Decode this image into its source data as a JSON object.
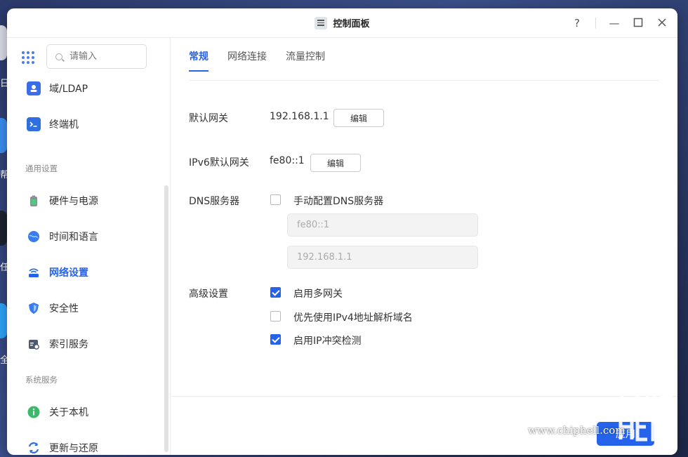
{
  "desktop": {
    "side_chars": [
      "日",
      "帮",
      "任",
      "全"
    ]
  },
  "window": {
    "title": "控制面板",
    "icon": "control-panel-icon"
  },
  "sidebar": {
    "search_placeholder": "请输入",
    "items": [
      {
        "label": "域/LDAP",
        "icon": "directory-icon"
      },
      {
        "label": "终端机",
        "icon": "terminal-icon"
      }
    ],
    "section_general": "通用设置",
    "general_items": [
      {
        "label": "硬件与电源",
        "icon": "hardware-power-icon"
      },
      {
        "label": "时间和语言",
        "icon": "globe-icon"
      },
      {
        "label": "网络设置",
        "icon": "network-icon"
      },
      {
        "label": "安全性",
        "icon": "shield-icon"
      },
      {
        "label": "索引服务",
        "icon": "index-service-icon"
      }
    ],
    "section_system": "系统服务",
    "system_items": [
      {
        "label": "关于本机",
        "icon": "info-icon"
      },
      {
        "label": "更新与还原",
        "icon": "refresh-icon"
      }
    ]
  },
  "tabs": [
    "常规",
    "网络连接",
    "流量控制"
  ],
  "form": {
    "default_gateway_label": "默认网关",
    "default_gateway_value": "192.168.1.1",
    "edit_label": "编辑",
    "ipv6_gateway_label": "IPv6默认网关",
    "ipv6_gateway_value": "fe80::1",
    "dns_label": "DNS服务器",
    "dns_manual_label": "手动配置DNS服务器",
    "dns_manual_checked": false,
    "dns_server_1": "fe80::1",
    "dns_server_2": "192.168.1.1",
    "advanced_label": "高级设置",
    "options": [
      {
        "label": "启用多网关",
        "checked": true
      },
      {
        "label": "优先使用IPv4地址解析域名",
        "checked": false
      },
      {
        "label": "启用IP冲突检测",
        "checked": true
      }
    ]
  },
  "footer": {
    "apply_label": "应用"
  },
  "watermark": {
    "text": "www.chiphell.com"
  },
  "colors": {
    "accent": "#2563eb"
  }
}
